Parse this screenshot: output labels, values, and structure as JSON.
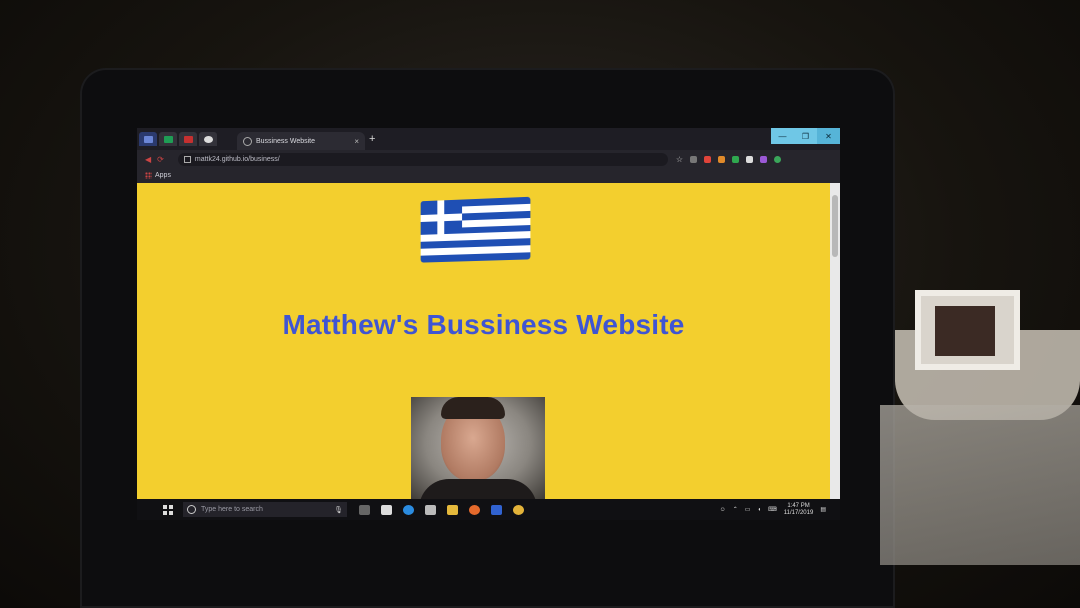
{
  "browser": {
    "tab_title": "Bussiness Website",
    "tab_close": "×",
    "new_tab": "+",
    "url": "mattk24.github.io/business/",
    "bookmark_apps": "Apps",
    "window_controls": {
      "minimize": "—",
      "maximize": "❐",
      "close": "✕"
    }
  },
  "page": {
    "background_color": "#f3cf2e",
    "title": "Matthew's Bussiness Website",
    "title_color": "#3f55d3",
    "flag": "greece-flag"
  },
  "taskbar": {
    "search_placeholder": "Type here to search",
    "time": "1:47 PM",
    "date": "11/17/2019"
  }
}
